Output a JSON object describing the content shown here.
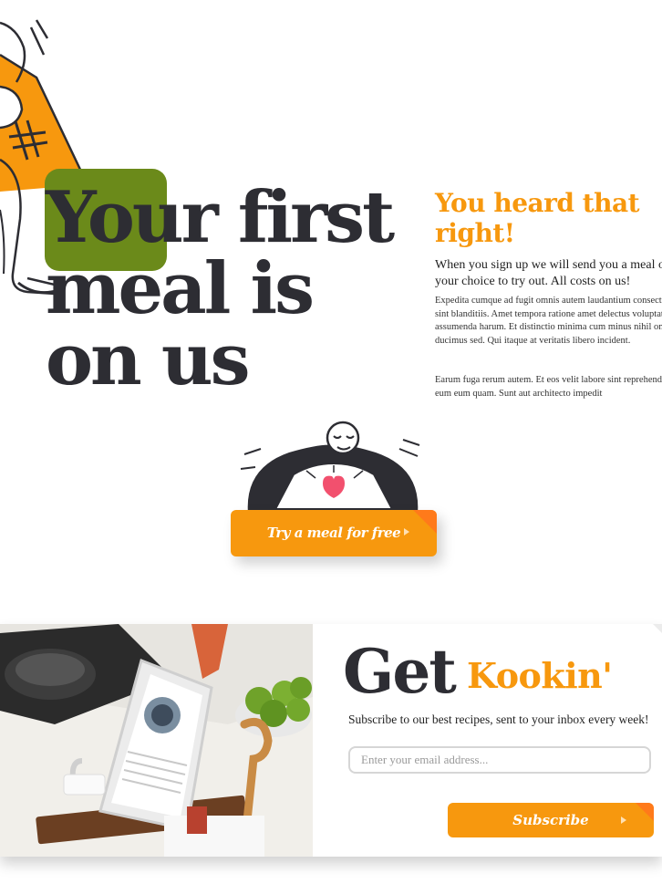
{
  "hero": {
    "headline_line1": "Your first",
    "headline_line2": "meal is",
    "headline_line3": "on us",
    "subhead": "You heard that right!",
    "intro": "When you sign up we will send you a meal of your choice to try out. All costs on us!",
    "body1": "Expedita cumque ad fugit omnis autem laudantium consectetur sint blanditiis. Amet tempora ratione amet delectus voluptatem assumenda harum. Et distinctio minima cum minus nihil omnis ducimus sed. Qui itaque at veritatis libero incident.",
    "body2": "Earum fuga rerum autem. Et eos velit labore sint reprehenderit eum eum quam. Sunt aut architecto impedit",
    "cta_label": "Try a meal for free"
  },
  "subscribe": {
    "title_get": "Get",
    "title_kookin": "Kookin'",
    "text": "Subscribe to our best recipes, sent to your inbox every week!",
    "email_placeholder": "Enter your email address...",
    "email_value": "",
    "button_label": "Subscribe"
  },
  "colors": {
    "accent": "#f7980e",
    "accent_dark": "#ff7a1a",
    "green": "#6b8a1a",
    "ink": "#2d2d33",
    "heart": "#f2506e"
  },
  "icons": {
    "hero_illustration": "person-holding-pizza-illustration",
    "heart_illustration": "person-with-heart-illustration",
    "button_arrow": "play-arrow-icon",
    "photo": "tablet-recipe-kitchen-photo"
  }
}
